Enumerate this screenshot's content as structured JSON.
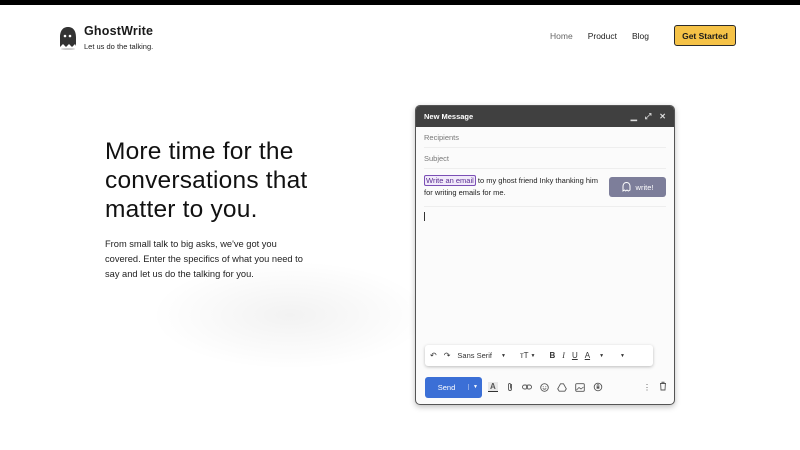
{
  "brand": {
    "name": "GhostWrite",
    "tagline": "Let us do the talking."
  },
  "nav": {
    "items": [
      "Home",
      "Product",
      "Blog"
    ],
    "cta": "Get Started"
  },
  "hero": {
    "title": "More time for the conversations that matter to you.",
    "body": "From small talk to big asks, we've got you covered. Enter the specifics of what you need to say and let us do the talking for you."
  },
  "compose": {
    "title": "New Message",
    "recipients_placeholder": "Recipients",
    "subject_placeholder": "Subject",
    "prompt_highlight": "Write an email",
    "prompt_rest": " to my ghost friend Inky thanking him for writing emails for me.",
    "write_button": "write!",
    "font_name": "Sans Serif",
    "send_label": "Send"
  },
  "colors": {
    "cta_bg": "#f5c247",
    "write_btn": "#7d7e9a",
    "send_btn": "#3b6fd6",
    "highlight": "#7b4fb5"
  }
}
